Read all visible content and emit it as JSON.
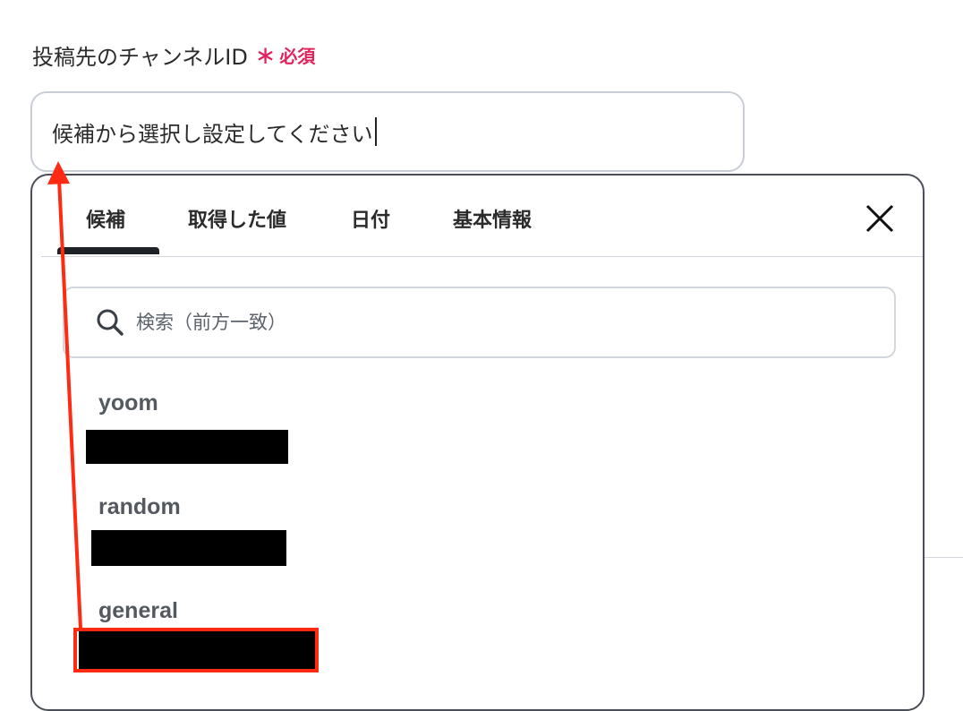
{
  "field": {
    "label": "投稿先のチャンネルID",
    "required_star": "∗",
    "required_text": "必須",
    "input_value": "候補から選択し設定してください"
  },
  "dropdown": {
    "tabs": [
      {
        "label": "候補",
        "active": true
      },
      {
        "label": "取得した値",
        "active": false
      },
      {
        "label": "日付",
        "active": false
      },
      {
        "label": "基本情報",
        "active": false
      }
    ],
    "close_icon": "close-icon",
    "search": {
      "placeholder": "検索（前方一致）",
      "icon": "search-icon"
    },
    "options": [
      {
        "name": "yoom",
        "id_redacted": true
      },
      {
        "name": "random",
        "id_redacted": true
      },
      {
        "name": "general",
        "id_redacted": true,
        "highlighted": true
      }
    ]
  },
  "annotation": {
    "color": "#ff2a12",
    "type": "red-arrow-and-box"
  },
  "colors": {
    "required": "#e0245e",
    "border": "#c9ced6",
    "annotation": "#ff2a12"
  }
}
